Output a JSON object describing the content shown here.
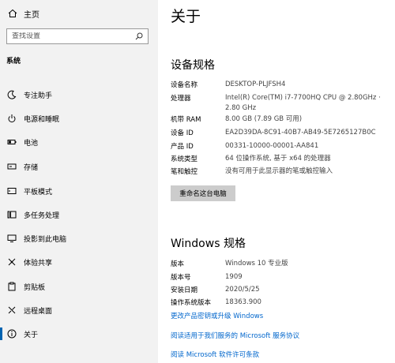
{
  "sidebar": {
    "home_label": "主页",
    "search_placeholder": "查找设置",
    "section_title": "系统",
    "items": [
      {
        "label": "专注助手",
        "icon": "moon-icon"
      },
      {
        "label": "电源和睡眠",
        "icon": "power-icon"
      },
      {
        "label": "电池",
        "icon": "battery-icon"
      },
      {
        "label": "存储",
        "icon": "storage-icon"
      },
      {
        "label": "平板模式",
        "icon": "tablet-icon"
      },
      {
        "label": "多任务处理",
        "icon": "multitask-icon"
      },
      {
        "label": "投影到此电脑",
        "icon": "project-icon"
      },
      {
        "label": "体验共享",
        "icon": "share-icon"
      },
      {
        "label": "剪贴板",
        "icon": "clipboard-icon"
      },
      {
        "label": "远程桌面",
        "icon": "remote-icon"
      },
      {
        "label": "关于",
        "icon": "info-icon",
        "active": true
      }
    ],
    "accent_color": "#0063b1"
  },
  "main": {
    "title": "关于",
    "device_specs": {
      "heading": "设备规格",
      "rows": [
        {
          "key": "设备名称",
          "value": "DESKTOP-PLJFSH4"
        },
        {
          "key": "处理器",
          "value": "Intel(R) Core(TM) i7-7700HQ CPU @ 2.80GHz · 2.80 GHz"
        },
        {
          "key": "机带 RAM",
          "value": "8.00 GB (7.89 GB 可用)"
        },
        {
          "key": "设备 ID",
          "value": "EA2D39DA-8C91-40B7-AB49-5E7265127B0C"
        },
        {
          "key": "产品 ID",
          "value": "00331-10000-00001-AA841"
        },
        {
          "key": "系统类型",
          "value": "64 位操作系统, 基于 x64 的处理器"
        },
        {
          "key": "笔和触控",
          "value": "没有可用于此显示器的笔或触控输入"
        }
      ],
      "rename_button": "重命名这台电脑"
    },
    "windows_specs": {
      "heading": "Windows 规格",
      "rows": [
        {
          "key": "版本",
          "value": "Windows 10 专业版"
        },
        {
          "key": "版本号",
          "value": "1909"
        },
        {
          "key": "安装日期",
          "value": "2020/5/25"
        },
        {
          "key": "操作系统版本",
          "value": "18363.900"
        }
      ],
      "links": [
        "更改产品密钥或升级 Windows",
        "阅读适用于我们服务的 Microsoft 服务协议",
        "阅读 Microsoft 软件许可条款"
      ],
      "link_color": "#0066cc"
    }
  }
}
